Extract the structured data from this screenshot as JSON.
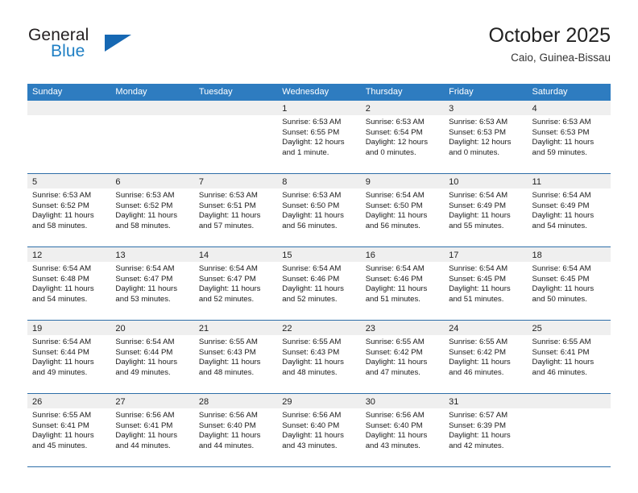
{
  "brand": {
    "word_one": "General",
    "word_two": "Blue",
    "triangle_icon": "logo-triangle-icon",
    "colors": {
      "text": "#231f20",
      "blue": "#1f7fc4",
      "triangle": "#1668b3"
    }
  },
  "header": {
    "title": "October 2025",
    "subtitle": "Caio, Guinea-Bissau"
  },
  "theme": {
    "header_bar": "#2e7cc0",
    "grid_line": "#2e6ea8",
    "day_head_bg": "#efefef"
  },
  "weekdays": [
    "Sunday",
    "Monday",
    "Tuesday",
    "Wednesday",
    "Thursday",
    "Friday",
    "Saturday"
  ],
  "weeks": [
    [
      {
        "day": "",
        "lines": []
      },
      {
        "day": "",
        "lines": []
      },
      {
        "day": "",
        "lines": []
      },
      {
        "day": "1",
        "lines": [
          "Sunrise: 6:53 AM",
          "Sunset: 6:55 PM",
          "Daylight: 12 hours",
          "and 1 minute."
        ]
      },
      {
        "day": "2",
        "lines": [
          "Sunrise: 6:53 AM",
          "Sunset: 6:54 PM",
          "Daylight: 12 hours",
          "and 0 minutes."
        ]
      },
      {
        "day": "3",
        "lines": [
          "Sunrise: 6:53 AM",
          "Sunset: 6:53 PM",
          "Daylight: 12 hours",
          "and 0 minutes."
        ]
      },
      {
        "day": "4",
        "lines": [
          "Sunrise: 6:53 AM",
          "Sunset: 6:53 PM",
          "Daylight: 11 hours",
          "and 59 minutes."
        ]
      }
    ],
    [
      {
        "day": "5",
        "lines": [
          "Sunrise: 6:53 AM",
          "Sunset: 6:52 PM",
          "Daylight: 11 hours",
          "and 58 minutes."
        ]
      },
      {
        "day": "6",
        "lines": [
          "Sunrise: 6:53 AM",
          "Sunset: 6:52 PM",
          "Daylight: 11 hours",
          "and 58 minutes."
        ]
      },
      {
        "day": "7",
        "lines": [
          "Sunrise: 6:53 AM",
          "Sunset: 6:51 PM",
          "Daylight: 11 hours",
          "and 57 minutes."
        ]
      },
      {
        "day": "8",
        "lines": [
          "Sunrise: 6:53 AM",
          "Sunset: 6:50 PM",
          "Daylight: 11 hours",
          "and 56 minutes."
        ]
      },
      {
        "day": "9",
        "lines": [
          "Sunrise: 6:54 AM",
          "Sunset: 6:50 PM",
          "Daylight: 11 hours",
          "and 56 minutes."
        ]
      },
      {
        "day": "10",
        "lines": [
          "Sunrise: 6:54 AM",
          "Sunset: 6:49 PM",
          "Daylight: 11 hours",
          "and 55 minutes."
        ]
      },
      {
        "day": "11",
        "lines": [
          "Sunrise: 6:54 AM",
          "Sunset: 6:49 PM",
          "Daylight: 11 hours",
          "and 54 minutes."
        ]
      }
    ],
    [
      {
        "day": "12",
        "lines": [
          "Sunrise: 6:54 AM",
          "Sunset: 6:48 PM",
          "Daylight: 11 hours",
          "and 54 minutes."
        ]
      },
      {
        "day": "13",
        "lines": [
          "Sunrise: 6:54 AM",
          "Sunset: 6:47 PM",
          "Daylight: 11 hours",
          "and 53 minutes."
        ]
      },
      {
        "day": "14",
        "lines": [
          "Sunrise: 6:54 AM",
          "Sunset: 6:47 PM",
          "Daylight: 11 hours",
          "and 52 minutes."
        ]
      },
      {
        "day": "15",
        "lines": [
          "Sunrise: 6:54 AM",
          "Sunset: 6:46 PM",
          "Daylight: 11 hours",
          "and 52 minutes."
        ]
      },
      {
        "day": "16",
        "lines": [
          "Sunrise: 6:54 AM",
          "Sunset: 6:46 PM",
          "Daylight: 11 hours",
          "and 51 minutes."
        ]
      },
      {
        "day": "17",
        "lines": [
          "Sunrise: 6:54 AM",
          "Sunset: 6:45 PM",
          "Daylight: 11 hours",
          "and 51 minutes."
        ]
      },
      {
        "day": "18",
        "lines": [
          "Sunrise: 6:54 AM",
          "Sunset: 6:45 PM",
          "Daylight: 11 hours",
          "and 50 minutes."
        ]
      }
    ],
    [
      {
        "day": "19",
        "lines": [
          "Sunrise: 6:54 AM",
          "Sunset: 6:44 PM",
          "Daylight: 11 hours",
          "and 49 minutes."
        ]
      },
      {
        "day": "20",
        "lines": [
          "Sunrise: 6:54 AM",
          "Sunset: 6:44 PM",
          "Daylight: 11 hours",
          "and 49 minutes."
        ]
      },
      {
        "day": "21",
        "lines": [
          "Sunrise: 6:55 AM",
          "Sunset: 6:43 PM",
          "Daylight: 11 hours",
          "and 48 minutes."
        ]
      },
      {
        "day": "22",
        "lines": [
          "Sunrise: 6:55 AM",
          "Sunset: 6:43 PM",
          "Daylight: 11 hours",
          "and 48 minutes."
        ]
      },
      {
        "day": "23",
        "lines": [
          "Sunrise: 6:55 AM",
          "Sunset: 6:42 PM",
          "Daylight: 11 hours",
          "and 47 minutes."
        ]
      },
      {
        "day": "24",
        "lines": [
          "Sunrise: 6:55 AM",
          "Sunset: 6:42 PM",
          "Daylight: 11 hours",
          "and 46 minutes."
        ]
      },
      {
        "day": "25",
        "lines": [
          "Sunrise: 6:55 AM",
          "Sunset: 6:41 PM",
          "Daylight: 11 hours",
          "and 46 minutes."
        ]
      }
    ],
    [
      {
        "day": "26",
        "lines": [
          "Sunrise: 6:55 AM",
          "Sunset: 6:41 PM",
          "Daylight: 11 hours",
          "and 45 minutes."
        ]
      },
      {
        "day": "27",
        "lines": [
          "Sunrise: 6:56 AM",
          "Sunset: 6:41 PM",
          "Daylight: 11 hours",
          "and 44 minutes."
        ]
      },
      {
        "day": "28",
        "lines": [
          "Sunrise: 6:56 AM",
          "Sunset: 6:40 PM",
          "Daylight: 11 hours",
          "and 44 minutes."
        ]
      },
      {
        "day": "29",
        "lines": [
          "Sunrise: 6:56 AM",
          "Sunset: 6:40 PM",
          "Daylight: 11 hours",
          "and 43 minutes."
        ]
      },
      {
        "day": "30",
        "lines": [
          "Sunrise: 6:56 AM",
          "Sunset: 6:40 PM",
          "Daylight: 11 hours",
          "and 43 minutes."
        ]
      },
      {
        "day": "31",
        "lines": [
          "Sunrise: 6:57 AM",
          "Sunset: 6:39 PM",
          "Daylight: 11 hours",
          "and 42 minutes."
        ]
      },
      {
        "day": "",
        "lines": []
      }
    ]
  ]
}
